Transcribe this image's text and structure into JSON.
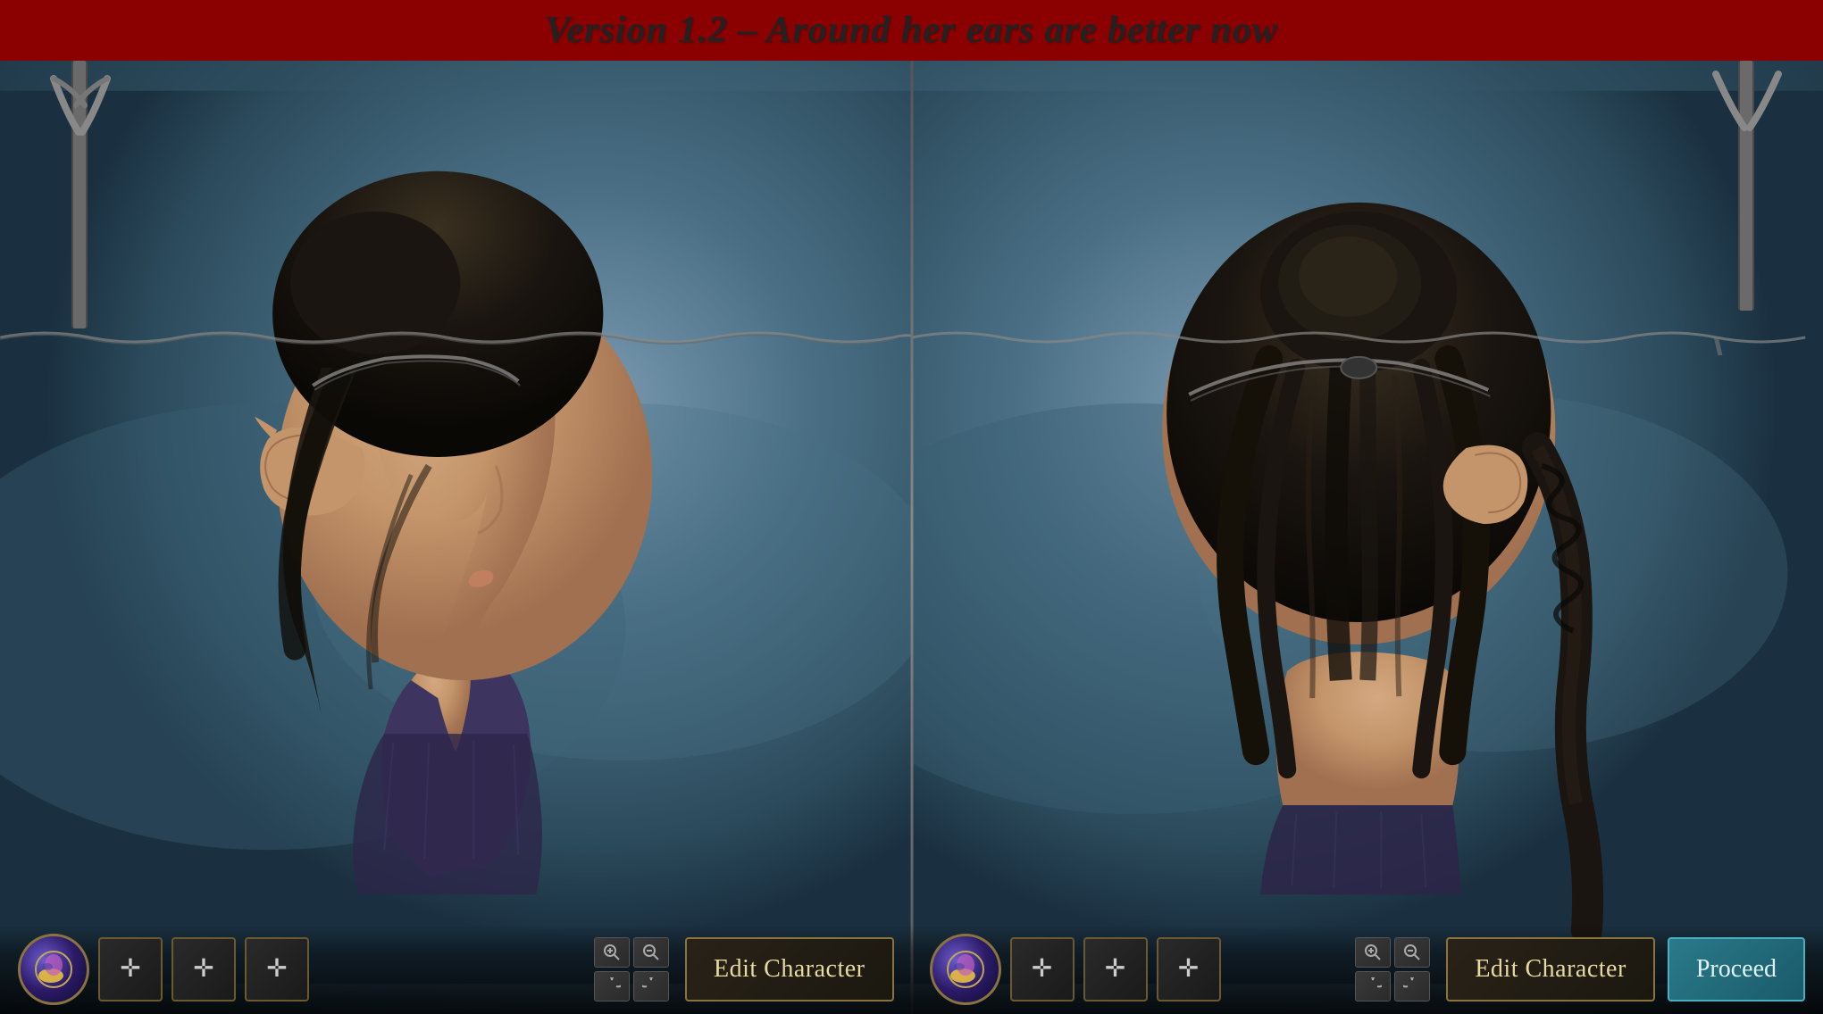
{
  "banner": {
    "title": "Version 1.2 – Around her ears are better now"
  },
  "panels": {
    "left": {
      "id": "panel-left",
      "view": "side-face-view"
    },
    "right": {
      "id": "panel-right",
      "view": "back-head-view"
    }
  },
  "hud_left": {
    "avatar_label": "avatar",
    "action_buttons": [
      {
        "label": "✚",
        "name": "action-btn-1"
      },
      {
        "label": "✚",
        "name": "action-btn-2"
      },
      {
        "label": "✚",
        "name": "action-btn-3"
      }
    ],
    "camera_up_left": "🔍",
    "camera_up_right": "🔍",
    "camera_down_left": "↺",
    "camera_down_right": "↻",
    "edit_character_label": "Edit Character"
  },
  "hud_right": {
    "avatar_label": "avatar",
    "action_buttons": [
      {
        "label": "✚",
        "name": "action-btn-r1"
      },
      {
        "label": "✚",
        "name": "action-btn-r2"
      },
      {
        "label": "✚",
        "name": "action-btn-r3"
      }
    ],
    "camera_up_left": "🔍",
    "camera_up_right": "🔍",
    "camera_down_left": "↺",
    "camera_down_right": "↻",
    "edit_character_label": "Edit Character",
    "proceed_label": "Proceed"
  },
  "colors": {
    "banner_bg": "#8b0000",
    "banner_text": "#222222",
    "hud_border": "#8b7340",
    "edit_btn_text": "#e8d9a0",
    "proceed_btn_bg": "#2a7a8a",
    "proceed_btn_border": "#4ab0c0",
    "proceed_btn_text": "#e0f4f8"
  }
}
